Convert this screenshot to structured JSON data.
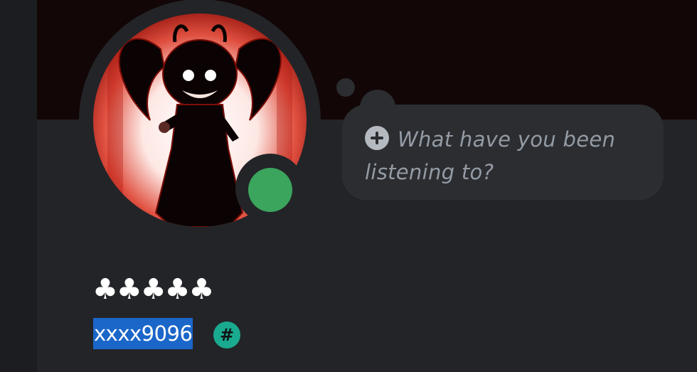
{
  "profile": {
    "display_name": "♣♣♣♣♣",
    "username": "xxxx9096",
    "username_badge_symbol": "#",
    "status": "online",
    "avatar_alt": "profile avatar",
    "banner_color": "#120606"
  },
  "thought_bubble": {
    "placeholder": "What have you been listening to?",
    "add_icon": "plus-circle-icon"
  },
  "colors": {
    "status_online": "#3ba55d",
    "username_badge": "#1aaa8f",
    "selection_highlight": "#1b66c9",
    "panel": "#232428",
    "bubble": "#2b2d31"
  }
}
